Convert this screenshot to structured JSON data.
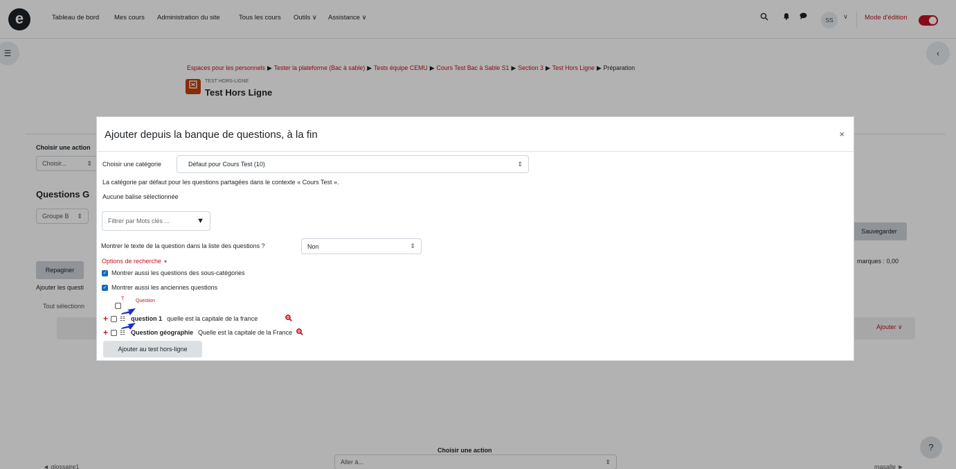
{
  "navbar": {
    "logo": "e",
    "links": [
      "Tableau de bord",
      "Mes cours",
      "Administration du site",
      "Tous les cours",
      "Outils ∨",
      "Assistance ∨"
    ],
    "user_initials": "SS",
    "user_chevron": "∨",
    "edit_mode_label": "Mode d'édition",
    "icons": [
      "search-icon",
      "bell-icon",
      "chat-icon"
    ]
  },
  "breadcrumb": {
    "items": [
      "Espaces pour les personnels",
      "Tester la plateforme (Bac à sable)",
      "Tests équipe CEMU",
      "Cours Test Bac à Sable S1",
      "Section 3",
      "Test Hors Ligne"
    ],
    "current": "Préparation",
    "separator": "▶"
  },
  "header": {
    "kicker": "TEST HORS-LIGNE",
    "title": "Test Hors Ligne"
  },
  "background": {
    "choose_action_label": "Choisir une action",
    "choose_select": "Choisir...",
    "questions_heading": "Questions G",
    "group_select": "Groupe B",
    "save_button": "Sauvegarder",
    "repaginate_button": "Repaginer",
    "marks_text": "marques : 0,00",
    "add_questions_text": "Ajouter les questi",
    "select_all_text": "Tout sélectionn",
    "add_button": "Ajouter ∨",
    "footer_action_label": "Choisir une action",
    "goto_select": "Aller à...",
    "prev_link": "◄ glossaire1",
    "next_link": "masalle ►",
    "help_button": "?"
  },
  "modal": {
    "title": "Ajouter depuis la banque de questions, à la fin",
    "close": "×",
    "category_label": "Choisir une catégorie",
    "category_value": "Défaut pour Cours Test (10)",
    "category_description": "La catégorie par défaut pour les questions partagées dans le contexte « Cours Test ».",
    "no_tag": "Aucune balise sélectionnée",
    "filter_placeholder": "Filtrer par Mots clés ...",
    "show_text_label": "Montrer le texte de la question dans la liste des questions ?",
    "show_text_value": "Non",
    "search_options": "Options de recherche",
    "check_subcategories": "Montrer aussi les questions des sous-catégories",
    "check_old": "Montrer aussi les anciennes questions",
    "table_header_type": "T",
    "table_header_question": "Question",
    "questions": [
      {
        "name": "question 1",
        "text": "quelle est la capitale de la france"
      },
      {
        "name": "Question géographie",
        "text": "Quelle est la capitale de la France"
      }
    ],
    "add_button": "Ajouter au test hors-ligne"
  },
  "colors": {
    "accent": "#c1121f",
    "checkbox": "#0f6cbf",
    "arrow": "#1a2bd6"
  }
}
